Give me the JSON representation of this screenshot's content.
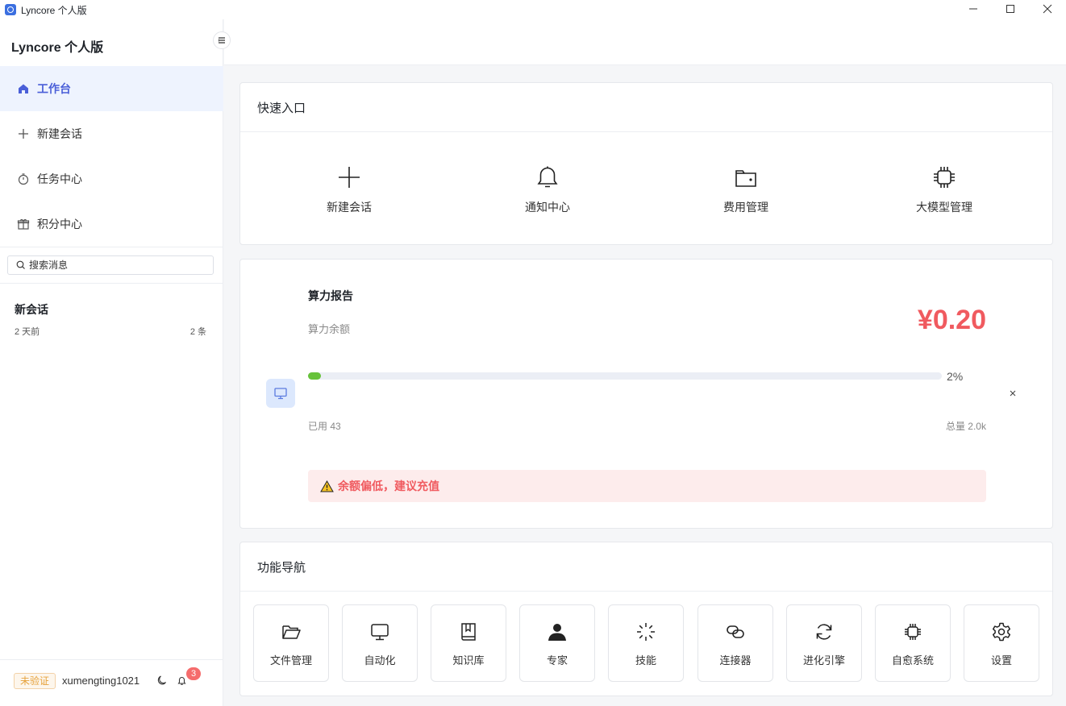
{
  "window": {
    "title": "Lyncore 个人版"
  },
  "sidebar": {
    "brand": "Lyncore 个人版",
    "nav": [
      {
        "label": "工作台",
        "icon": "home-icon",
        "active": true
      },
      {
        "label": "新建会话",
        "icon": "plus-icon"
      },
      {
        "label": "任务中心",
        "icon": "stopwatch-icon"
      },
      {
        "label": "积分中心",
        "icon": "gift-icon"
      }
    ],
    "search_placeholder": "搜索消息",
    "conversations": [
      {
        "title": "新会话",
        "time": "2 天前",
        "count": "2 条"
      }
    ],
    "user": {
      "badge": "未验证",
      "name": "xumengting1021",
      "notifications": "3"
    }
  },
  "quick_entry": {
    "title": "快速入口",
    "items": [
      {
        "label": "新建会话",
        "icon": "plus-icon"
      },
      {
        "label": "通知中心",
        "icon": "bell-icon"
      },
      {
        "label": "费用管理",
        "icon": "wallet-icon"
      },
      {
        "label": "大模型管理",
        "icon": "chip-icon"
      }
    ]
  },
  "compute_report": {
    "title": "算力报告",
    "subtitle": "算力余额",
    "balance": "¥0.20",
    "percent_label": "2%",
    "percent_value": 2,
    "used": "已用 43",
    "total": "总量 2.0k",
    "warning": "余额偏低，建议充值",
    "accent_color": "#f05a5f",
    "progress_color": "#67c23a"
  },
  "feature_nav": {
    "title": "功能导航",
    "items": [
      {
        "label": "文件管理",
        "icon": "folder-open-icon"
      },
      {
        "label": "自动化",
        "icon": "monitor-icon"
      },
      {
        "label": "知识库",
        "icon": "book-icon"
      },
      {
        "label": "专家",
        "icon": "person-icon"
      },
      {
        "label": "技能",
        "icon": "loader-icon"
      },
      {
        "label": "连接器",
        "icon": "link-icon"
      },
      {
        "label": "进化引擎",
        "icon": "refresh-icon"
      },
      {
        "label": "自愈系统",
        "icon": "chip-icon"
      },
      {
        "label": "设置",
        "icon": "gear-icon"
      }
    ]
  }
}
